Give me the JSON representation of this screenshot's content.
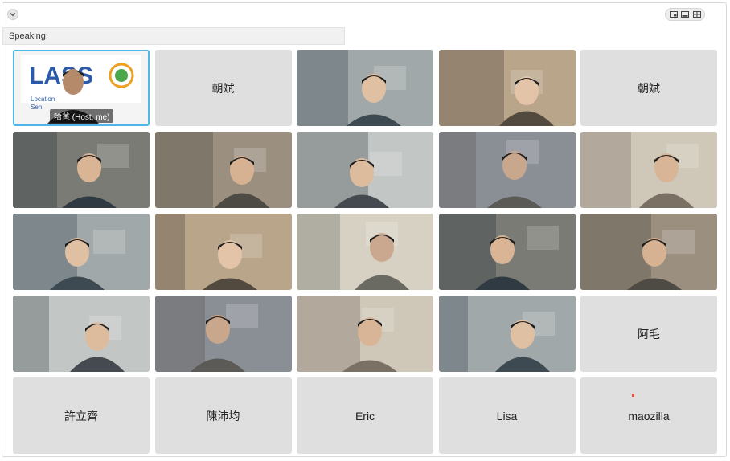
{
  "toolbar": {
    "collapse_icon": "chevron-down-icon",
    "view_icons": [
      "speaker-view-icon",
      "filmstrip-view-icon",
      "gallery-view-icon"
    ]
  },
  "speaking": {
    "label": "Speaking:"
  },
  "participants": [
    {
      "name": "哈爸",
      "tag": "哈爸  (Host, me)",
      "video": true,
      "logo_text": "LASS",
      "logo_sub": "Location\nSen"
    },
    {
      "name": "朝斌",
      "video": false
    },
    {
      "name": "",
      "video": true
    },
    {
      "name": "",
      "video": true
    },
    {
      "name": "朝斌",
      "video": false
    },
    {
      "name": "",
      "video": true
    },
    {
      "name": "",
      "video": true
    },
    {
      "name": "",
      "video": true
    },
    {
      "name": "",
      "video": true
    },
    {
      "name": "",
      "video": true
    },
    {
      "name": "",
      "video": true
    },
    {
      "name": "",
      "video": true
    },
    {
      "name": "",
      "video": true
    },
    {
      "name": "",
      "video": true
    },
    {
      "name": "",
      "video": true
    },
    {
      "name": "",
      "video": true
    },
    {
      "name": "",
      "video": true
    },
    {
      "name": "",
      "video": true
    },
    {
      "name": "",
      "video": true
    },
    {
      "name": "阿毛",
      "video": false
    },
    {
      "name": "許立齊",
      "video": false
    },
    {
      "name": "陳沛均",
      "video": false
    },
    {
      "name": "Eric",
      "video": false
    },
    {
      "name": "Lisa",
      "video": false
    },
    {
      "name": "maozilla",
      "video": false
    }
  ],
  "colors": {
    "self_border": "#4fb6e8",
    "tile_bg": "#dfdfdf"
  }
}
